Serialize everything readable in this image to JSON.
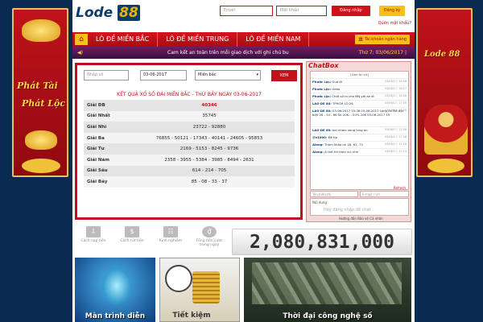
{
  "banners": {
    "left_lines": [
      "Phát Tài",
      "Phát Lộc"
    ],
    "right_logo": "Lode 88"
  },
  "header": {
    "logo_main": "Lode",
    "logo_num": "88",
    "email_placeholder": "Email",
    "password_placeholder": "Mật khẩu",
    "login_label": "Đăng nhập",
    "register_label": "Đăng ký",
    "forgot_label": "Quên mật khẩu?"
  },
  "nav": {
    "items": [
      "LÔ ĐỀ MIỀN BẮC",
      "LÔ ĐỀ MIỀN TRUNG",
      "LÔ ĐỀ MIỀN NAM"
    ],
    "bank_label": "Tài khoản ngân hàng"
  },
  "ticker": {
    "message": "Cam kết an toàn trên mỗi giao dịch với ghi chú bu",
    "date": "Thứ 7: 03/06/2017 |"
  },
  "results": {
    "input_placeholder": "Nhập số",
    "date_value": "03-06-2017",
    "region_value": "Miền bắc",
    "view_label": "XEM",
    "title": "KẾT QUẢ XỔ SỐ ĐÀI MIỀN BẮC - THỨ BẢY NGÀY 03-06-2017",
    "rows": [
      {
        "label": "Giải ĐB",
        "value": "40346"
      },
      {
        "label": "Giải Nhất",
        "value": "35745"
      },
      {
        "label": "Giải Nhì",
        "value": "23722 - 92880"
      },
      {
        "label": "Giải Ba",
        "value": "76855 - 50121 - 17343 - 40141 - 24605 - 95853"
      },
      {
        "label": "Giải Tư",
        "value": "2169 - 5153 - 8245 - 9736"
      },
      {
        "label": "Giải Năm",
        "value": "2358 - 3955 - 5384 - 3985 - 8494 - 2631"
      },
      {
        "label": "Giải Sáu",
        "value": "614 - 214 - 705"
      },
      {
        "label": "Giải Bảy",
        "value": "85 - 08 - 33 - 37"
      }
    ]
  },
  "chat": {
    "title": "ChatBox",
    "filter": "[Gán tin cũ]",
    "messages": [
      {
        "user": "Phước Lộc:",
        "text": "Gud đi",
        "time": "03/06/17, 16:56"
      },
      {
        "user": "Phước Lộc:",
        "text": "Haha",
        "time": "03/06/17, 16:57"
      },
      {
        "user": "Phước Lộc:",
        "text": "Chốt số ra cho MN với ae đi",
        "time": "03/06/17, 16:58"
      },
      {
        "user": "LAO DE 80:",
        "text": "TPHCM LÔ 26",
        "time": "03/06/17, 17:00"
      },
      {
        "user": "LAO DE 80:",
        "text": "03-06-2017 15:38 03-06-2017 Long An Đề đặc biệt 26 - 34 - 66 5K 20K... 20% 20K 03-06-2017 15",
        "time": "03/06/17, 17:05"
      },
      {
        "user": "LAO DE 80:",
        "text": "bel nham sang long an",
        "time": "03/06/17, 17:08"
      },
      {
        "user": "@x1000:",
        "text": "Đề tịp",
        "time": "03/06/17, 17:08"
      },
      {
        "user": "Along:",
        "text": "Thám khảo nh 16, 61, 73",
        "time": "03/06/17, 17:10"
      },
      {
        "user": "Along:",
        "text": "Ai ket thì theo vui nhe",
        "time": "03/06/17, 17:13"
      }
    ],
    "refresh": "Refresh",
    "name_placeholder": "Tên hiển thị",
    "email_placeholder": "E-mail / Url",
    "content_label": "Nội dung",
    "content_placeholder": "Hãy đăng nhập để chat",
    "footer": "Hướng dẫn   Bảo vệ   Cá nhân"
  },
  "stats": {
    "items": [
      "Cách nạp tiền",
      "Cách rút tiền",
      "Kinh nghiệm",
      "Tổng tiền cược trong ngày"
    ],
    "total": "2,080,831,000"
  },
  "promos": [
    "Màn trình diễn",
    "Tiết kiệm",
    "Thời đại công nghệ số"
  ]
}
